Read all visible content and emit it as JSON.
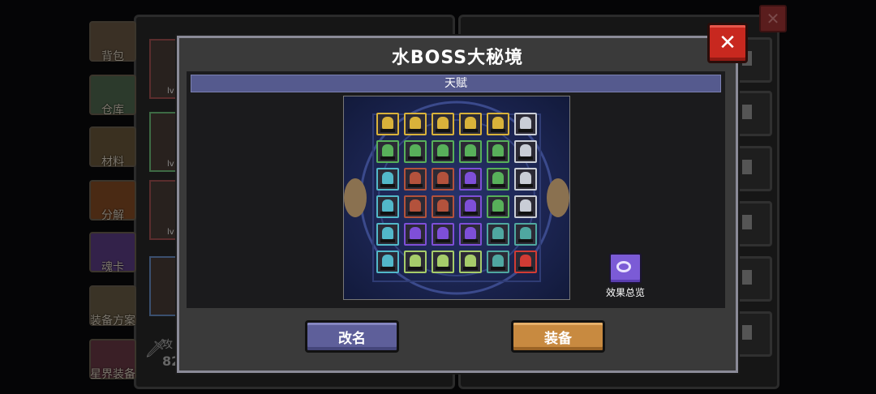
{
  "background": {
    "sidebar": [
      {
        "label": "背包",
        "color": "#3a3025"
      },
      {
        "label": "仓库",
        "color": "#2c3a2c"
      },
      {
        "label": "材料",
        "color": "#3a3020"
      },
      {
        "label": "分解",
        "color": "#4a2a14"
      },
      {
        "label": "魂卡",
        "color": "#33224a"
      },
      {
        "label": "装备方案",
        "color": "#3a3326"
      },
      {
        "label": "星界装备",
        "color": "#3a1f26"
      }
    ],
    "card_level_label": "lv",
    "attack_label": "攻",
    "attack_value": "82"
  },
  "dialog": {
    "title": "水BOSS大秘境",
    "close_symbol": "✕",
    "section_label": "天赋",
    "overview_label": "效果总览",
    "buttons": {
      "rename": "改名",
      "equip": "装备"
    }
  },
  "talent_grid": {
    "rows": 6,
    "cols": 6,
    "colors": {
      "yellow": "#d9b23a",
      "green": "#58b05a",
      "red": "#b3523c",
      "purple": "#7e4fd8",
      "teal": "#4fa7a0",
      "cyan": "#52b8c9",
      "lime": "#a6cc6a",
      "silver": "#c9cdd6",
      "crimson": "#d23b34"
    },
    "cells": [
      [
        "yellow",
        "yellow",
        "yellow",
        "yellow",
        "yellow",
        "silver"
      ],
      [
        "green",
        "green",
        "green",
        "green",
        "green",
        "silver"
      ],
      [
        "cyan",
        "red",
        "red",
        "purple",
        "green",
        "silver"
      ],
      [
        "cyan",
        "red",
        "red",
        "purple",
        "green",
        "silver"
      ],
      [
        "cyan",
        "purple",
        "purple",
        "purple",
        "teal",
        "teal"
      ],
      [
        "cyan",
        "lime",
        "lime",
        "lime",
        "teal",
        "crimson"
      ]
    ]
  }
}
